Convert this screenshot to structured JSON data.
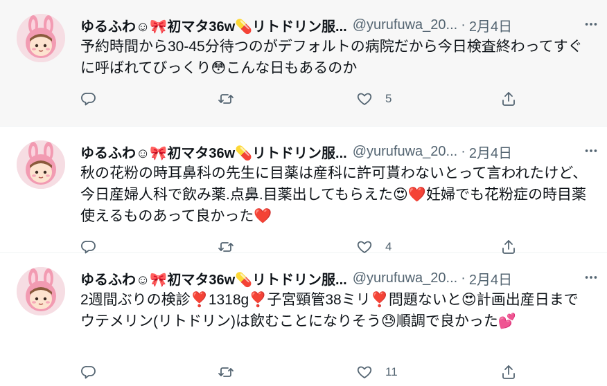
{
  "tweets": [
    {
      "name": "ゆるふわ☺🎀初マタ36w💊リトドリン服...",
      "handle": "@yurufuwa_20...",
      "separator": "·",
      "date": "2月4日",
      "more_icon": "more-horizontal-icon",
      "text": "予約時間から30-45分待つのがデフォルトの病院だから今日検査終わってすぐに呼ばれてびっくり😳こんな日もあるのか",
      "reply_count": "",
      "retweet_count": "",
      "like_count": "5"
    },
    {
      "name": "ゆるふわ☺🎀初マタ36w💊リトドリン服...",
      "handle": "@yurufuwa_20...",
      "separator": "·",
      "date": "2月4日",
      "more_icon": "more-horizontal-icon",
      "text": "秋の花粉の時耳鼻科の先生に目薬は産科に許可貰わないとって言われたけど、今日産婦人科で飲み薬.点鼻.目薬出してもらえた😍❤️妊婦でも花粉症の時目薬使えるものあって良かった❤️",
      "reply_count": "",
      "retweet_count": "",
      "like_count": "4"
    },
    {
      "name": "ゆるふわ☺🎀初マタ36w💊リトドリン服...",
      "handle": "@yurufuwa_20...",
      "separator": "·",
      "date": "2月4日",
      "more_icon": "more-horizontal-icon",
      "text": "2週間ぶりの検診❣️1318g❣️子宮頸管38ミリ❣️問題ないと😍計画出産日までウテメリン(リトドリン)は飲むことになりそう😓順調で良かった💕",
      "reply_count": "",
      "retweet_count": "",
      "like_count": "11"
    }
  ],
  "colors": {
    "text": "#0f1419",
    "secondary": "#536471",
    "hover_bg": "#f7f7f7",
    "avatar_pink": "#f4a7b9"
  }
}
